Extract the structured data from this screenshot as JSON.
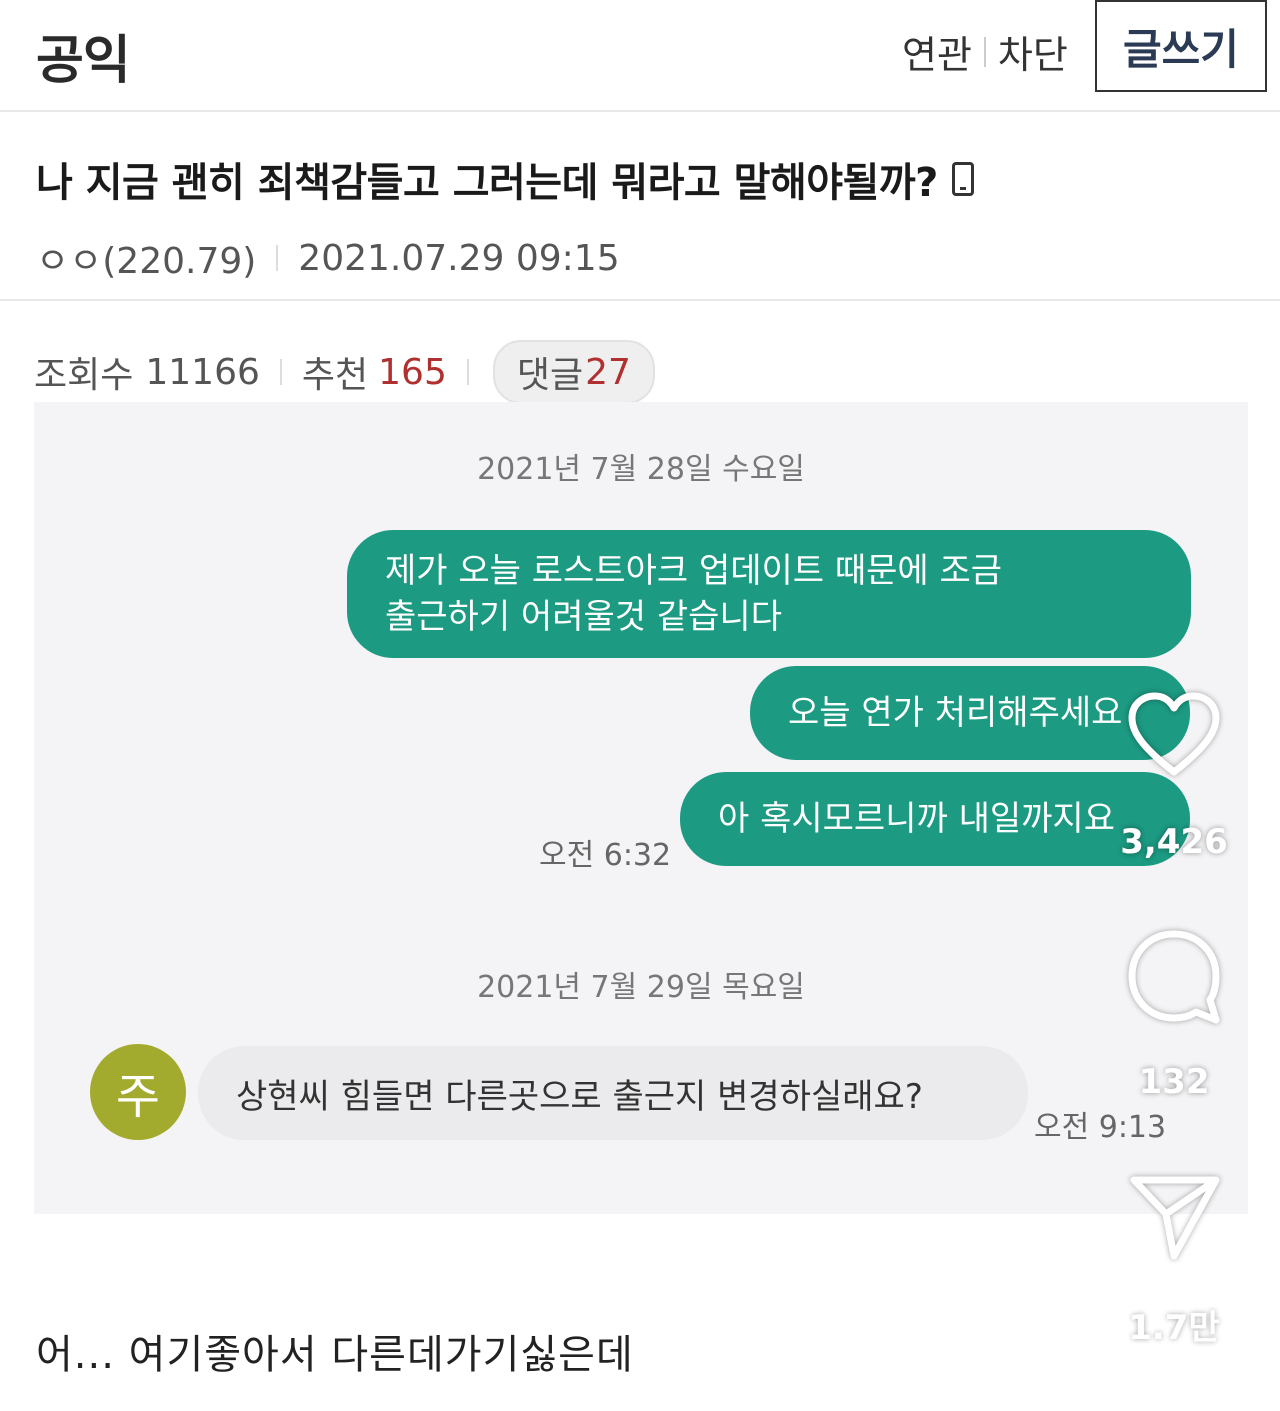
{
  "header": {
    "gallery_title": "공익",
    "related_link": "연관",
    "block_link": "차단",
    "write_button": "글쓰기"
  },
  "post": {
    "title": "나 지금 괜히 죄책감들고 그러는데 뭐라고 말해야될까?",
    "author": "ㅇㅇ(220.79)",
    "datetime": "2021.07.29 09:15",
    "views_label": "조회수",
    "views": "11166",
    "recommend_label": "추천",
    "recommend": "165",
    "comments_label": "댓글",
    "comments": "27",
    "body": "어... 여기좋아서 다른데가기싫은데"
  },
  "chat": {
    "date1": "2021년 7월 28일 수요일",
    "msg1_line1": "제가 오늘 로스트아크 업데이트 때문에 조금",
    "msg1_line2": "출근하기 어려울것 같습니다",
    "msg2": "오늘 연가 처리해주세요",
    "msg3": "아 혹시모르니까 내일까지요",
    "time1": "오전 6:32",
    "date2": "2021년 7월 29일 목요일",
    "avatar_char": "주",
    "reply": "상현씨 힘들면 다른곳으로 출근지 변경하실래요?",
    "time2": "오전 9:13",
    "colors": {
      "sent_bubble": "#1c9a82",
      "received_bubble": "#ebebed",
      "avatar": "#a3ab2e"
    }
  },
  "overlay": {
    "likes": "3,426",
    "comments": "132",
    "shares": "1.7만",
    "icons": [
      "heart-icon",
      "comment-bubble-icon",
      "send-icon"
    ]
  }
}
